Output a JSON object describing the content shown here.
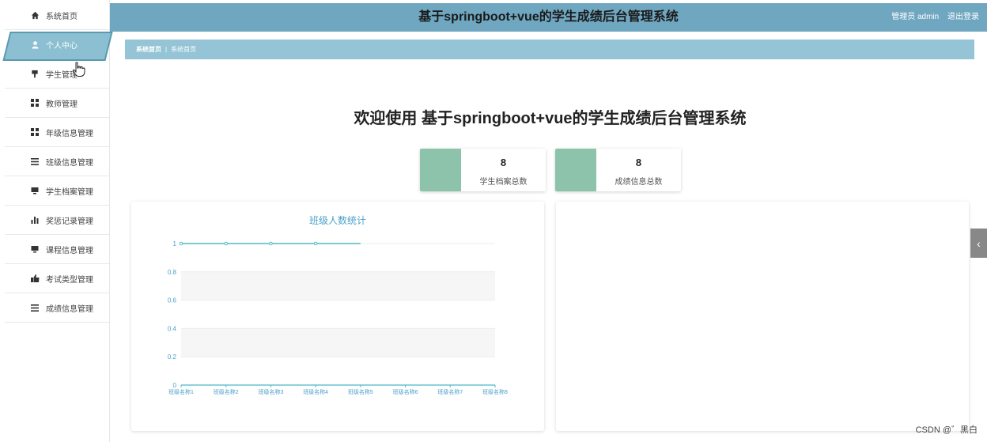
{
  "sidebar": {
    "items": [
      {
        "label": "系统首页",
        "icon": "home-icon"
      },
      {
        "label": "个人中心",
        "icon": "user-icon",
        "active": true
      },
      {
        "label": "学生管理",
        "icon": "flag-icon"
      },
      {
        "label": "教师管理",
        "icon": "grid-icon"
      },
      {
        "label": "年级信息管理",
        "icon": "grid-icon"
      },
      {
        "label": "班级信息管理",
        "icon": "list-icon"
      },
      {
        "label": "学生档案管理",
        "icon": "monitor-icon"
      },
      {
        "label": "奖惩记录管理",
        "icon": "bar-chart-icon"
      },
      {
        "label": "课程信息管理",
        "icon": "monitor-icon"
      },
      {
        "label": "考试类型管理",
        "icon": "thumb-icon"
      },
      {
        "label": "成绩信息管理",
        "icon": "list-icon"
      }
    ]
  },
  "header": {
    "title": "基于springboot+vue的学生成绩后台管理系统",
    "user_label": "管理员 admin",
    "logout_label": "退出登录"
  },
  "breadcrumb": {
    "home": "系统首页",
    "separator": "|",
    "current": "系统首页"
  },
  "welcome": "欢迎使用 基于springboot+vue的学生成绩后台管理系统",
  "stats": [
    {
      "value": "8",
      "label": "学生档案总数"
    },
    {
      "value": "8",
      "label": "成绩信息总数"
    }
  ],
  "side_tab_glyph": "‹",
  "watermark": "CSDN @゛黑白",
  "colors": {
    "header": "#6fa6c0",
    "breadcrumb": "#94c4d5",
    "stat_swatch": "#8dc3aa",
    "chart_line": "#4ab8c8"
  },
  "chart_data": {
    "type": "line",
    "title": "班级人数统计",
    "categories": [
      "班级名称1",
      "班级名称2",
      "班级名称3",
      "班级名称4",
      "班级名称5",
      "班级名称6",
      "班级名称7",
      "班级名称8"
    ],
    "values": [
      1,
      1,
      1,
      1,
      1
    ],
    "ylim": [
      0,
      1
    ],
    "yticks": [
      "0",
      "0.2",
      "0.4",
      "0.6",
      "0.8",
      "1"
    ]
  }
}
